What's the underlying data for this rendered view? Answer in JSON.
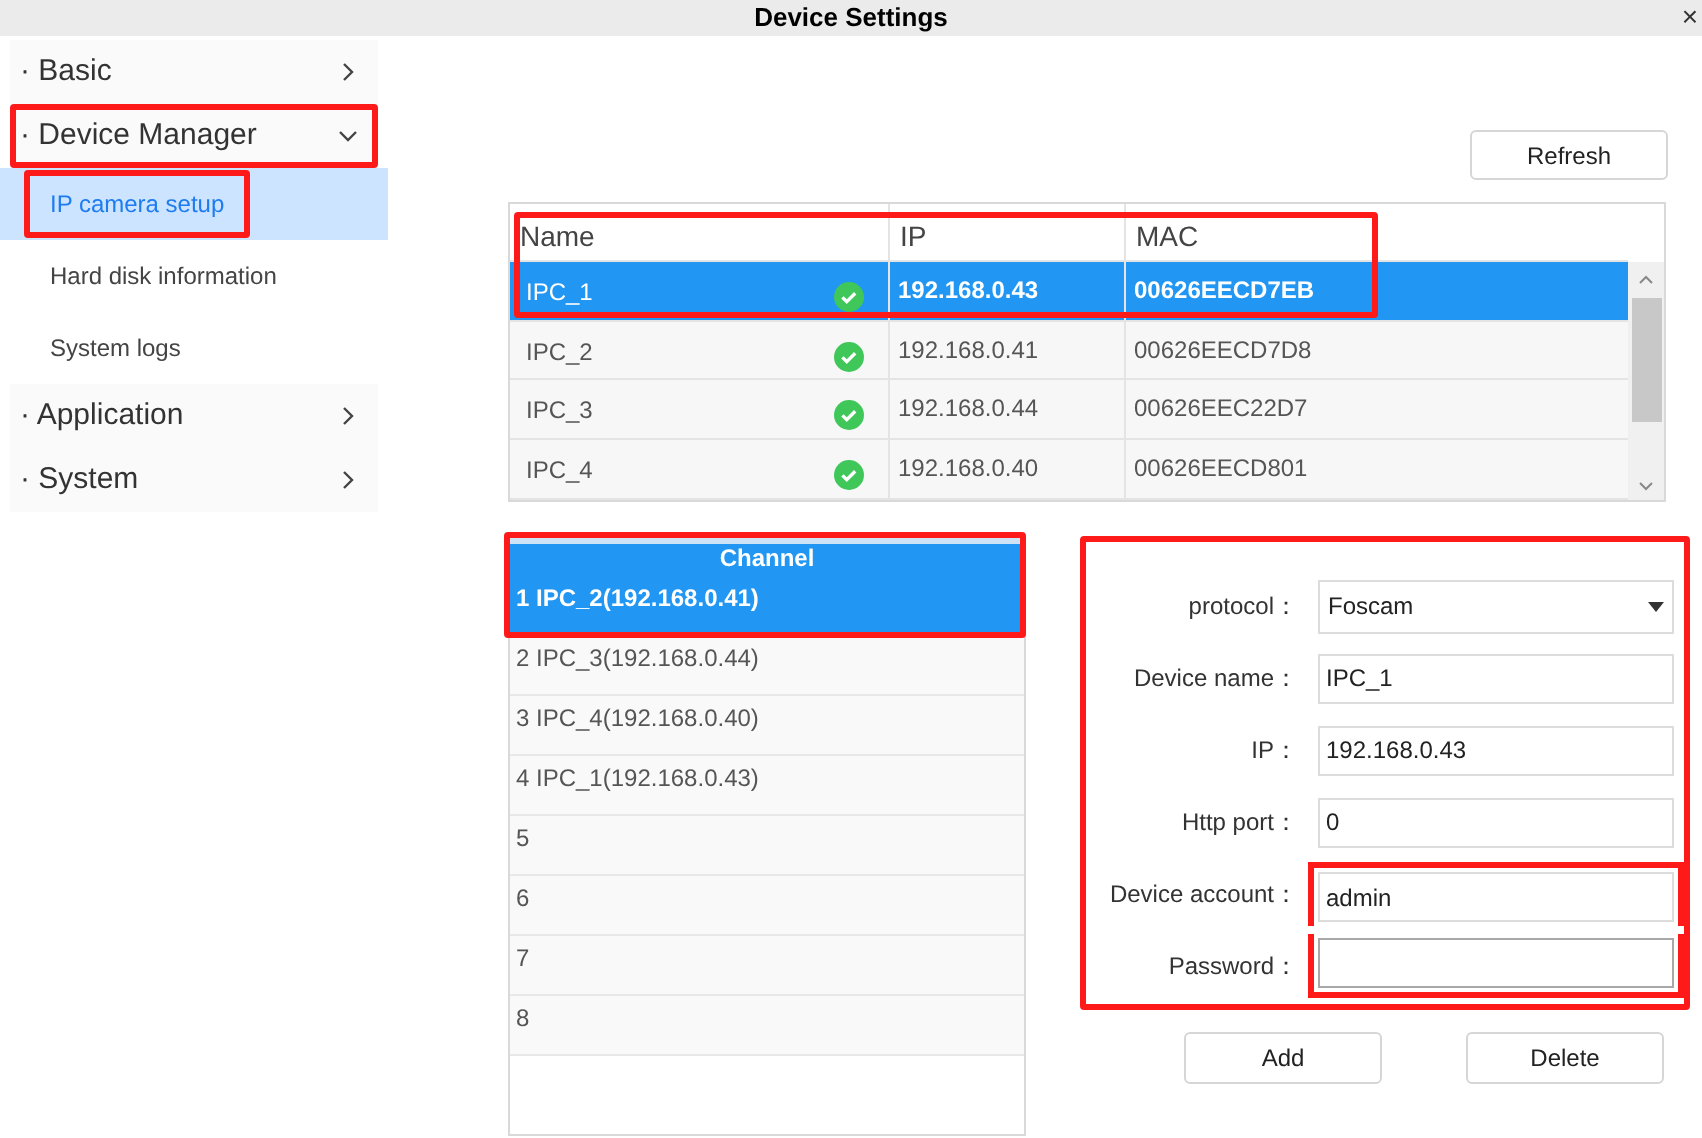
{
  "window": {
    "title": "Device Settings",
    "close": "×"
  },
  "sidebar": {
    "items": [
      {
        "label": "· Basic",
        "expanded": false,
        "highlighted": false
      },
      {
        "label": "· Device Manager",
        "expanded": true,
        "highlighted": true,
        "children": [
          {
            "label": "IP camera setup",
            "selected": true,
            "highlighted": true
          },
          {
            "label": "Hard disk information",
            "selected": false,
            "highlighted": false
          },
          {
            "label": "System logs",
            "selected": false,
            "highlighted": false
          }
        ]
      },
      {
        "label": "· Application",
        "expanded": false,
        "highlighted": false
      },
      {
        "label": "· System",
        "expanded": false,
        "highlighted": false
      }
    ]
  },
  "refresh_button": "Refresh",
  "device_table": {
    "highlighted": true,
    "columns": [
      "Name",
      "IP",
      "MAC"
    ],
    "rows": [
      {
        "name": "IPC_1",
        "online": true,
        "ip": "192.168.0.43",
        "mac": "00626EECD7EB",
        "selected": true
      },
      {
        "name": "IPC_2",
        "online": true,
        "ip": "192.168.0.41",
        "mac": "00626EECD7D8",
        "selected": false
      },
      {
        "name": "IPC_3",
        "online": true,
        "ip": "192.168.0.44",
        "mac": "00626EEC22D7",
        "selected": false
      },
      {
        "name": "IPC_4",
        "online": true,
        "ip": "192.168.0.40",
        "mac": "00626EECD801",
        "selected": false
      }
    ]
  },
  "channel_list": {
    "title": "Channel",
    "highlighted": true,
    "items": [
      {
        "label": "1 IPC_2(192.168.0.41)",
        "selected": true
      },
      {
        "label": "2 IPC_3(192.168.0.44)",
        "selected": false
      },
      {
        "label": "3 IPC_4(192.168.0.40)",
        "selected": false
      },
      {
        "label": "4 IPC_1(192.168.0.43)",
        "selected": false
      },
      {
        "label": "5",
        "selected": false
      },
      {
        "label": "6",
        "selected": false
      },
      {
        "label": "7",
        "selected": false
      },
      {
        "label": "8",
        "selected": false
      }
    ]
  },
  "form": {
    "highlighted": true,
    "fields": [
      {
        "kind": "select",
        "label": "protocol：",
        "value": "Foscam",
        "highlighted": false
      },
      {
        "kind": "text",
        "label": "Device name：",
        "value": "IPC_1",
        "highlighted": false
      },
      {
        "kind": "text",
        "label": "IP：",
        "value": "192.168.0.43",
        "highlighted": false
      },
      {
        "kind": "text",
        "label": "Http port：",
        "value": "0",
        "highlighted": false
      },
      {
        "kind": "text",
        "label": "Device account：",
        "value": "admin",
        "highlighted": true
      },
      {
        "kind": "password",
        "label": "Password：",
        "highlighted": true
      }
    ]
  },
  "buttons": [
    "Add",
    "Delete"
  ]
}
